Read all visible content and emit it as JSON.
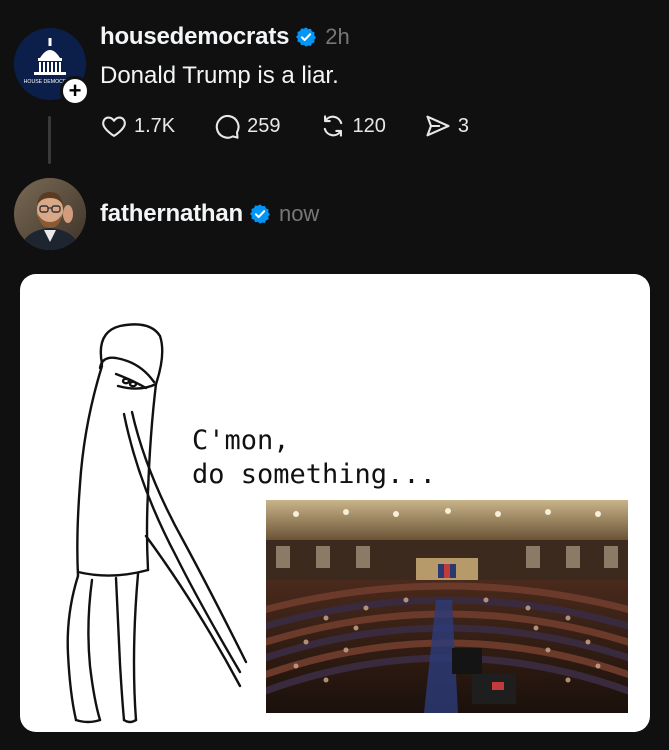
{
  "post1": {
    "username": "housedemocrats",
    "verified": true,
    "timestamp": "2h",
    "text": "Donald Trump is a liar.",
    "avatar_text": "HOUSE DEMOCRATS",
    "follow_icon": "plus-icon",
    "actions": {
      "likes": "1.7K",
      "replies": "259",
      "reposts": "120",
      "shares": "3"
    }
  },
  "post2": {
    "username": "fathernathan",
    "verified": true,
    "timestamp": "now",
    "media": {
      "caption_line1": "C'mon,",
      "caption_line2": "do something..."
    }
  },
  "colors": {
    "background": "#101010",
    "verified_blue": "#0095f6",
    "muted_text": "#777777",
    "primary_text": "#f3f5f7"
  }
}
